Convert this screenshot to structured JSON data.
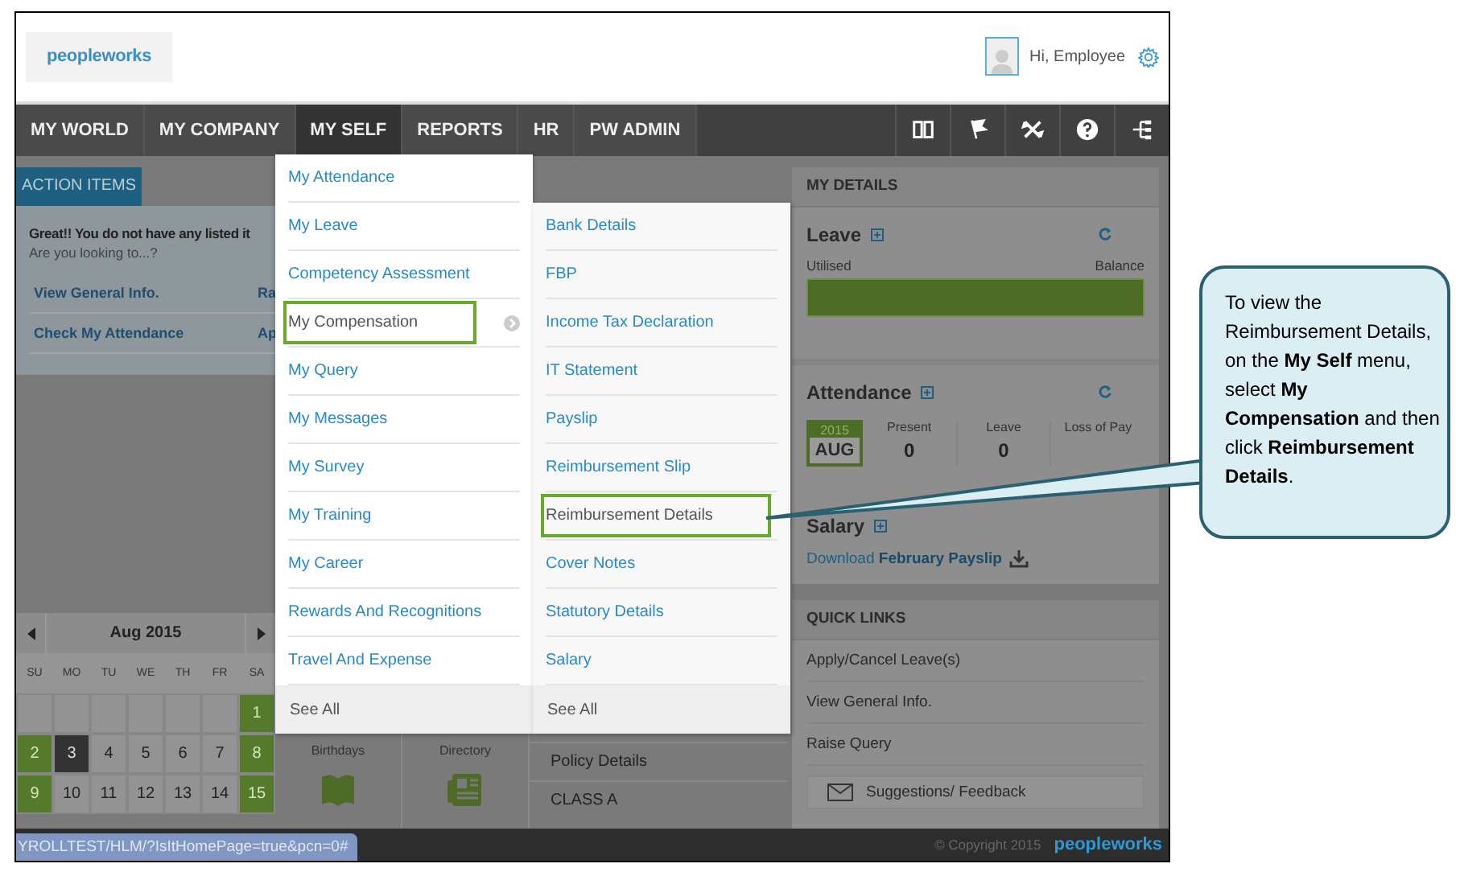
{
  "header": {
    "logo": "peopleworks",
    "greeting": "Hi, Employee"
  },
  "nav": {
    "items": [
      {
        "label": "MY WORLD",
        "selected": false
      },
      {
        "label": "MY COMPANY",
        "selected": false
      },
      {
        "label": "MY SELF",
        "selected": true
      },
      {
        "label": "REPORTS",
        "selected": false
      },
      {
        "label": "HR",
        "selected": false
      },
      {
        "label": "PW ADMIN",
        "selected": false
      }
    ]
  },
  "action_items": {
    "tab": "ACTION ITEMS",
    "message": "Great!! You do not have any listed it",
    "prompt": "Are you looking to...?",
    "links": [
      "View General Info.",
      "Ra",
      "Check My Attendance",
      "Ap"
    ]
  },
  "calendar": {
    "month": "Aug 2015",
    "weekdays": [
      "SU",
      "MO",
      "TU",
      "WE",
      "TH",
      "FR",
      "SA"
    ],
    "weeks": [
      [
        {
          "kind": "empty"
        },
        {
          "kind": "empty"
        },
        {
          "kind": "empty"
        },
        {
          "kind": "empty"
        },
        {
          "kind": "empty"
        },
        {
          "kind": "empty"
        },
        {
          "kind": "weekend",
          "day": "1"
        }
      ],
      [
        {
          "kind": "weekend",
          "day": "2"
        },
        {
          "kind": "today",
          "day": "3"
        },
        {
          "kind": "day",
          "day": "4"
        },
        {
          "kind": "day",
          "day": "5"
        },
        {
          "kind": "day",
          "day": "6"
        },
        {
          "kind": "day",
          "day": "7"
        },
        {
          "kind": "weekend",
          "day": "8"
        }
      ],
      [
        {
          "kind": "weekend",
          "day": "9"
        },
        {
          "kind": "day",
          "day": "10"
        },
        {
          "kind": "day",
          "day": "11"
        },
        {
          "kind": "day",
          "day": "12"
        },
        {
          "kind": "day",
          "day": "13"
        },
        {
          "kind": "day",
          "day": "14"
        },
        {
          "kind": "weekend",
          "day": "15"
        }
      ]
    ]
  },
  "middle": {
    "tiles": [
      "Birthdays",
      "Directory"
    ],
    "list": [
      "Policy Details",
      "CLASS A"
    ]
  },
  "menu": {
    "columns": [
      {
        "items": [
          {
            "label": "My Attendance",
            "highlighted": false,
            "has_submenu": false
          },
          {
            "label": "My Leave",
            "highlighted": false,
            "has_submenu": false
          },
          {
            "label": "Competency Assessment",
            "highlighted": false,
            "has_submenu": false
          },
          {
            "label": "My Compensation",
            "highlighted": true,
            "has_submenu": true
          },
          {
            "label": "My Query",
            "highlighted": false,
            "has_submenu": false
          },
          {
            "label": "My Messages",
            "highlighted": false,
            "has_submenu": false
          },
          {
            "label": "My Survey",
            "highlighted": false,
            "has_submenu": false
          },
          {
            "label": "My Training",
            "highlighted": false,
            "has_submenu": false
          },
          {
            "label": "My Career",
            "highlighted": false,
            "has_submenu": false
          },
          {
            "label": "Rewards And Recognitions",
            "highlighted": false,
            "has_submenu": false
          },
          {
            "label": "Travel And Expense",
            "highlighted": false,
            "has_submenu": false
          }
        ],
        "footer": "See All"
      },
      {
        "items": [
          {
            "label": "Bank Details",
            "highlighted": false,
            "has_submenu": false
          },
          {
            "label": "FBP",
            "highlighted": false,
            "has_submenu": false
          },
          {
            "label": "Income Tax Declaration",
            "highlighted": false,
            "has_submenu": false
          },
          {
            "label": "IT Statement",
            "highlighted": false,
            "has_submenu": false
          },
          {
            "label": "Payslip",
            "highlighted": false,
            "has_submenu": false
          },
          {
            "label": "Reimbursement Slip",
            "highlighted": false,
            "has_submenu": false
          },
          {
            "label": "Reimbursement Details",
            "highlighted": true,
            "has_submenu": false
          },
          {
            "label": "Cover Notes",
            "highlighted": false,
            "has_submenu": false
          },
          {
            "label": "Statutory Details",
            "highlighted": false,
            "has_submenu": false
          },
          {
            "label": "Salary",
            "highlighted": false,
            "has_submenu": false
          }
        ],
        "footer": "See All"
      }
    ]
  },
  "my_details": {
    "title": "MY DETAILS",
    "leave": {
      "title": "Leave",
      "utilised_label": "Utilised",
      "balance_label": "Balance",
      "level": 1
    },
    "attendance": {
      "title": "Attendance",
      "year": "2015",
      "month": "AUG",
      "stats": [
        {
          "label": "Present",
          "value": "0"
        },
        {
          "label": "Leave",
          "value": "0"
        },
        {
          "label": "Loss of Pay"
        }
      ]
    },
    "salary": {
      "title": "Salary",
      "download": "Download **February Payslip**"
    }
  },
  "quick_links": {
    "title": "QUICK LINKS",
    "items": [
      "Apply/Cancel Leave(s)",
      "View General Info.",
      "Raise Query"
    ],
    "feedback": "Suggestions/ Feedback"
  },
  "footer": {
    "status_url": "YROLLTEST/HLM/?IsItHomePage=true&pcn=0#",
    "copyright": "© Copyright 2015",
    "logo": "peopleworks"
  },
  "callout": {
    "text": "To view the Reimbursement Details, on the **My Self** menu, select **My Compensation** and then click **Reimbursement Details**."
  }
}
